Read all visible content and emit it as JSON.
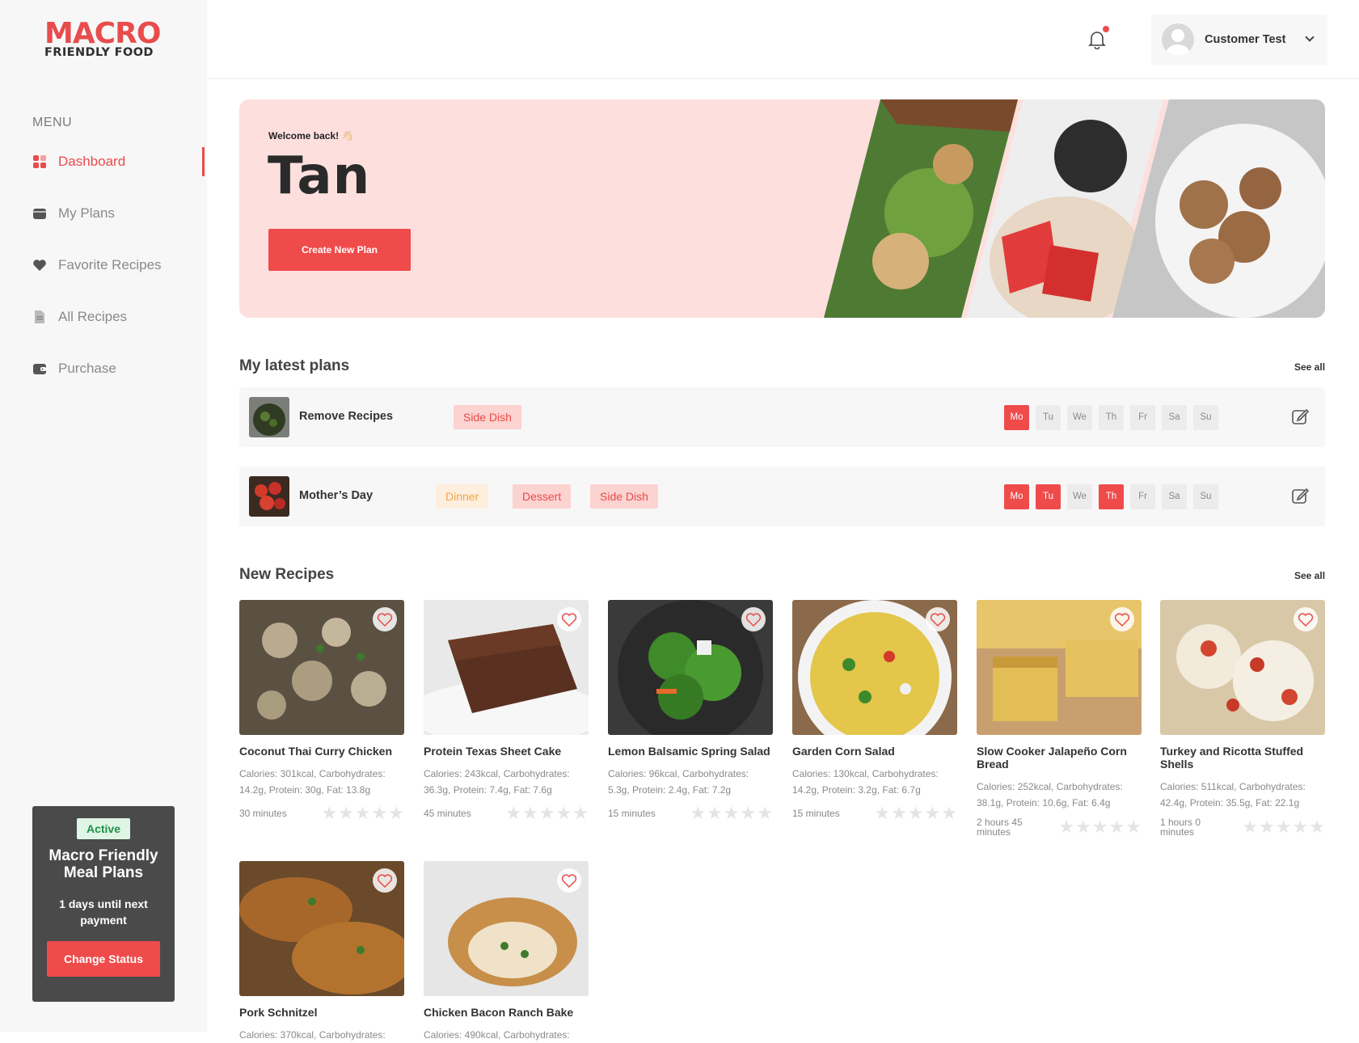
{
  "logo": {
    "line1": "MACRO",
    "line2": "FRIENDLY FOOD"
  },
  "sidebar": {
    "menu_title": "MENU",
    "items": [
      {
        "label": "Dashboard",
        "icon": "dashboard-icon",
        "active": true
      },
      {
        "label": "My Plans",
        "icon": "folder-icon"
      },
      {
        "label": "Favorite Recipes",
        "icon": "heart-icon"
      },
      {
        "label": "All Recipes",
        "icon": "document-icon"
      },
      {
        "label": "Purchase",
        "icon": "wallet-icon"
      }
    ]
  },
  "status_card": {
    "badge": "Active",
    "title": "Macro Friendly Meal Plans",
    "text": "1 days until next payment",
    "button": "Change Status"
  },
  "header": {
    "user_name": "Customer Test"
  },
  "hero": {
    "welcome": "Welcome back! 👋🏻",
    "name": "Tan",
    "button": "Create New Plan"
  },
  "plans": {
    "title": "My latest plans",
    "see_all": "See all",
    "rows": [
      {
        "name": "Remove Recipes",
        "tags": [
          "Side Dish"
        ],
        "days": [
          "Mo",
          "Tu",
          "We",
          "Th",
          "Fr",
          "Sa",
          "Su"
        ],
        "active_days": [
          "Mo"
        ]
      },
      {
        "name": "Mother’s Day",
        "tags": [
          "Dinner",
          "Dessert",
          "Side Dish"
        ],
        "days": [
          "Mo",
          "Tu",
          "We",
          "Th",
          "Fr",
          "Sa",
          "Su"
        ],
        "active_days": [
          "Mo",
          "Tu",
          "Th"
        ]
      }
    ]
  },
  "recipes": {
    "title": "New Recipes",
    "see_all": "See all",
    "items": [
      {
        "title": "Coconut Thai Curry Chicken",
        "macros": "Calories: 301kcal, Carbohydrates: 14.2g, Protein: 30g, Fat: 13.8g",
        "time": "30 minutes",
        "rating": 0
      },
      {
        "title": "Protein Texas Sheet Cake",
        "macros": "Calories: 243kcal, Carbohydrates: 36.3g, Protein: 7.4g, Fat: 7.6g",
        "time": "45 minutes",
        "rating": 0
      },
      {
        "title": "Lemon Balsamic Spring Salad",
        "macros": "Calories: 96kcal, Carbohydrates: 5.3g, Protein: 2.4g, Fat: 7.2g",
        "time": "15 minutes",
        "rating": 0
      },
      {
        "title": "Garden Corn Salad",
        "macros": "Calories: 130kcal, Carbohydrates: 14.2g, Protein: 3.2g, Fat: 6.7g",
        "time": "15 minutes",
        "rating": 0
      },
      {
        "title": "Slow Cooker Jalapeño Corn Bread",
        "macros": "Calories: 252kcal, Carbohydrates: 38.1g, Protein: 10.6g, Fat: 6.4g",
        "time": "2 hours 45 minutes",
        "rating": 0
      },
      {
        "title": "Turkey and Ricotta Stuffed Shells",
        "macros": "Calories: 511kcal, Carbohydrates: 42.4g, Protein: 35.5g, Fat: 22.1g",
        "time": "1 hours 0 minutes",
        "rating": 0
      },
      {
        "title": "Pork Schnitzel",
        "macros": "Calories: 370kcal, Carbohydrates:",
        "time": "",
        "rating": 0
      },
      {
        "title": "Chicken Bacon Ranch Bake",
        "macros": "Calories: 490kcal, Carbohydrates:",
        "time": "",
        "rating": 0
      }
    ]
  },
  "colors": {
    "accent": "#ef4b4b",
    "sidebar_bg": "#f7f7f7",
    "hero_bg": "#fde0de"
  }
}
